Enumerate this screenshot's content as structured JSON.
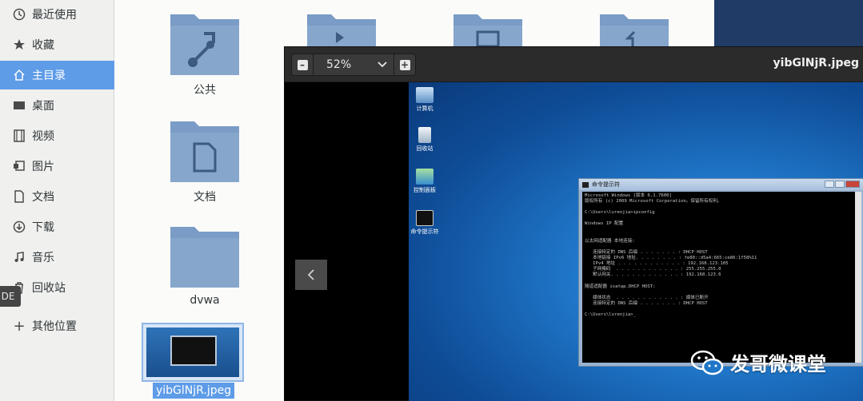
{
  "sidebar": {
    "items": [
      {
        "label": "最近使用",
        "icon": "clock-icon"
      },
      {
        "label": "收藏",
        "icon": "star-icon"
      },
      {
        "label": "主目录",
        "icon": "home-icon"
      },
      {
        "label": "桌面",
        "icon": "desktop-icon"
      },
      {
        "label": "视频",
        "icon": "video-icon"
      },
      {
        "label": "图片",
        "icon": "image-icon"
      },
      {
        "label": "文档",
        "icon": "document-icon"
      },
      {
        "label": "下载",
        "icon": "download-icon"
      },
      {
        "label": "音乐",
        "icon": "music-icon"
      },
      {
        "label": "回收站",
        "icon": "trash-icon"
      }
    ],
    "other_locations": "其他位置",
    "badge": "DE"
  },
  "files": [
    {
      "label": "公共",
      "icon": "share-folder-icon"
    },
    {
      "label": "文档",
      "icon": "document-folder-icon"
    },
    {
      "label": "dvwa",
      "icon": "folder-icon"
    },
    {
      "label": "yibGlNjR.jpeg",
      "icon": "image-thumbnail"
    }
  ],
  "viewer": {
    "zoom": "52%",
    "title": "yibGlNjR.jpeg"
  },
  "screenshot": {
    "desktop_icons": [
      "计算机",
      "回收站",
      "控制面板",
      "命令提示符"
    ],
    "cmd_title": "命令提示符",
    "cmd_lines": [
      "Microsoft Windows [版本 6.1.7600]",
      "版权所有 (c) 2009 Microsoft Corporation。保留所有权利。",
      "",
      "C:\\Users\\lurenjia>ipconfig",
      "",
      "Windows IP 配置",
      "",
      "",
      "以太网适配器 本地连接:",
      "",
      "   连接特定的 DNS 后缀 . . . . . . . : DHCP HOST",
      "   本地链接 IPv6 地址. . . . . . . . : fe80::d5a4:665:ce86:1f58%11",
      "   IPv4 地址 . . . . . . . . . . . . : 192.168.123.105",
      "   子网掩码  . . . . . . . . . . . . : 255.255.255.0",
      "   默认网关. . . . . . . . . . . . . : 192.168.123.6",
      "",
      "隧道适配器 isatap.DHCP HOST:",
      "",
      "   媒体状态  . . . . . . . . . . . . : 媒体已断开",
      "   连接特定的 DNS 后缀 . . . . . . . : DHCP HOST",
      "",
      "C:\\Users\\lurenjia>_"
    ]
  },
  "watermark": "发哥微课堂",
  "colors": {
    "accent": "#5e9ce8",
    "folder": "#7a9cc6"
  }
}
